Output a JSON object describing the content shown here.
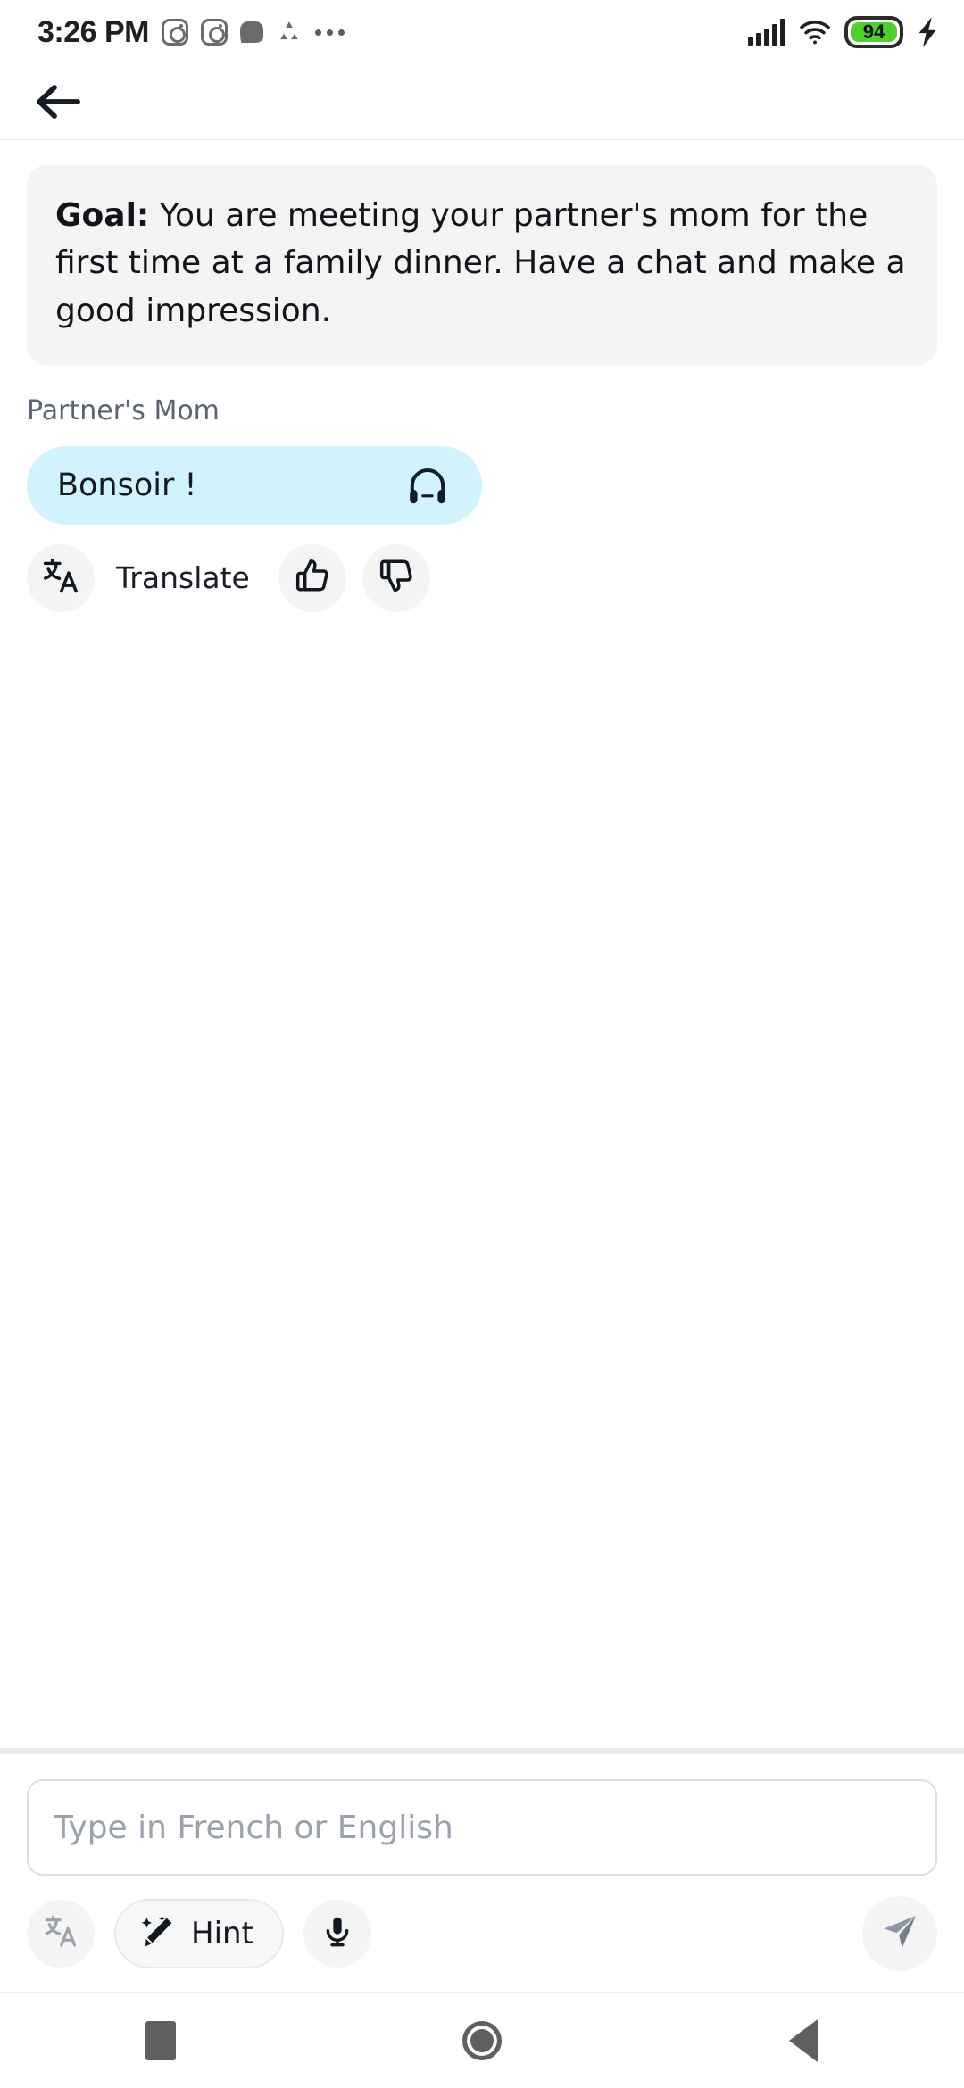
{
  "statusbar": {
    "time": "3:26 PM",
    "left_icons": [
      "instagram-icon",
      "instagram-icon",
      "chat-bubble-icon",
      "recycle-icon",
      "more-icon"
    ],
    "right_icons": [
      "cellular-signal-icon",
      "wifi-icon",
      "battery-icon",
      "charging-bolt-icon"
    ],
    "battery_level": "94",
    "battery_color": "#4fd02a"
  },
  "header": {
    "back_label": "Back"
  },
  "goal": {
    "label": "Goal:",
    "text": " You are meeting your partner's mom for the first time at a family dinner. Have a chat and make a good impression.",
    "card_bg": "#f4f4f5"
  },
  "conversation": {
    "speaker": "Partner's Mom",
    "messages": [
      {
        "text": "Bonsoir !",
        "bubble_color": "#d1f3fc",
        "audio_icon": "headphones-icon"
      }
    ],
    "actions": {
      "translate_label": "Translate",
      "translate_icon": "translate-icon",
      "thumbs_up_icon": "thumbs-up-icon",
      "thumbs_down_icon": "thumbs-down-icon"
    }
  },
  "composer": {
    "placeholder": "Type in French or English",
    "value": "",
    "translate_icon": "translate-icon-disabled",
    "hint_label": "Hint",
    "hint_icon": "magic-wand-icon",
    "mic_icon": "microphone-icon",
    "send_icon": "send-icon"
  },
  "navbar": {
    "recents_label": "Recents",
    "home_label": "Home",
    "back_label": "Back"
  }
}
